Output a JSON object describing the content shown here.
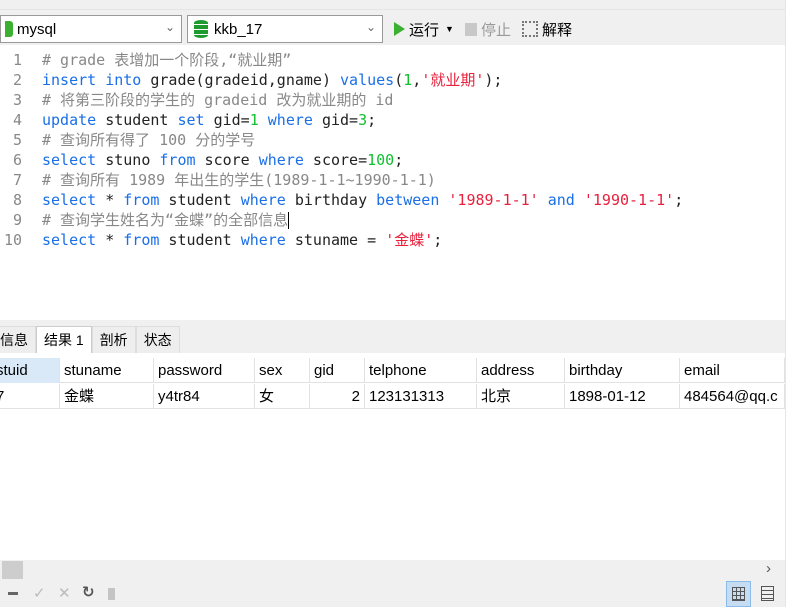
{
  "toolbar": {
    "connection": "mysql",
    "database": "kkb_17",
    "run_label": "运行",
    "stop_label": "停止",
    "explain_label": "解释"
  },
  "editor": {
    "lines": [
      [
        [
          "# grade 表增加一个阶段,“就业期”",
          "c"
        ]
      ],
      [
        [
          "insert",
          "k"
        ],
        [
          " ",
          "p"
        ],
        [
          "into",
          "k"
        ],
        [
          " grade(gradeid,gname) ",
          "p"
        ],
        [
          "values",
          "k"
        ],
        [
          "(",
          "p"
        ],
        [
          "1",
          "n"
        ],
        [
          ",",
          "p"
        ],
        [
          "'就业期'",
          "s"
        ],
        [
          ");",
          "p"
        ]
      ],
      [
        [
          "# 将第三阶段的学生的 gradeid 改为就业期的 id",
          "c"
        ]
      ],
      [
        [
          "update",
          "k"
        ],
        [
          " student ",
          "p"
        ],
        [
          "set",
          "k"
        ],
        [
          " gid=",
          "p"
        ],
        [
          "1",
          "n"
        ],
        [
          " ",
          "p"
        ],
        [
          "where",
          "k"
        ],
        [
          " gid=",
          "p"
        ],
        [
          "3",
          "n"
        ],
        [
          ";",
          "p"
        ]
      ],
      [
        [
          "# 查询所有得了 100 分的学号",
          "c"
        ]
      ],
      [
        [
          "select",
          "k"
        ],
        [
          " stuno ",
          "p"
        ],
        [
          "from",
          "k"
        ],
        [
          " score ",
          "p"
        ],
        [
          "where",
          "k"
        ],
        [
          " score=",
          "p"
        ],
        [
          "100",
          "n"
        ],
        [
          ";",
          "p"
        ]
      ],
      [
        [
          "# 查询所有 1989 年出生的学生(1989-1-1~1990-1-1)",
          "c"
        ]
      ],
      [
        [
          "select",
          "k"
        ],
        [
          " * ",
          "p"
        ],
        [
          "from",
          "k"
        ],
        [
          " student ",
          "p"
        ],
        [
          "where",
          "k"
        ],
        [
          " birthday ",
          "p"
        ],
        [
          "between",
          "k"
        ],
        [
          " ",
          "p"
        ],
        [
          "'1989-1-1'",
          "s"
        ],
        [
          " ",
          "p"
        ],
        [
          "and",
          "k"
        ],
        [
          " ",
          "p"
        ],
        [
          "'1990-1-1'",
          "s"
        ],
        [
          ";",
          "p"
        ]
      ],
      [
        [
          "# 查询学生姓名为“金蝶”的全部信息",
          "c"
        ]
      ],
      [
        [
          "select",
          "k"
        ],
        [
          " * ",
          "p"
        ],
        [
          "from",
          "k"
        ],
        [
          " student ",
          "p"
        ],
        [
          "where",
          "k"
        ],
        [
          " stuname = ",
          "p"
        ],
        [
          "'金蝶'",
          "s"
        ],
        [
          ";",
          "p"
        ]
      ]
    ]
  },
  "result_tabs": [
    "信息",
    "结果 1",
    "剖析",
    "状态"
  ],
  "result_table": {
    "columns": [
      "stuid",
      "stuname",
      "password",
      "sex",
      "gid",
      "telphone",
      "address",
      "birthday",
      "email"
    ],
    "rows": [
      [
        "7",
        "金蝶",
        "y4tr84",
        "女",
        "2",
        "123131313",
        "北京",
        "1898-01-12",
        "484564@qq.c"
      ]
    ]
  },
  "colors": {
    "keyword": "#1a6fe8",
    "number": "#10c030",
    "string": "#e8203c",
    "comment": "#888888",
    "run": "#3cb030"
  }
}
